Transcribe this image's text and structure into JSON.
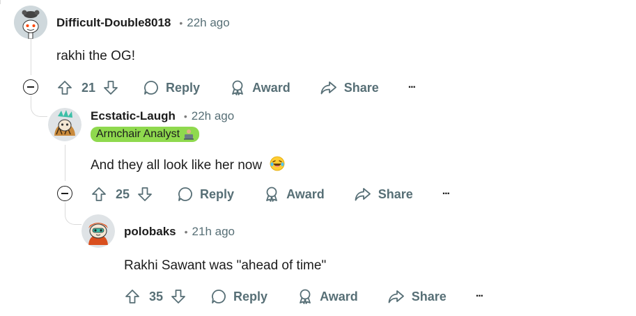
{
  "comments": [
    {
      "username": "Difficult-Double8018",
      "separator": "•",
      "time": "22h ago",
      "body": "rakhi the OG!",
      "score": "21",
      "actions": {
        "reply": "Reply",
        "award": "Award",
        "share": "Share",
        "more": "···"
      }
    },
    {
      "username": "Ecstatic-Laugh",
      "separator": "•",
      "time": "22h ago",
      "flair": "Armchair Analyst",
      "body": "And they all look like her now",
      "score": "25",
      "actions": {
        "reply": "Reply",
        "award": "Award",
        "share": "Share",
        "more": "···"
      }
    },
    {
      "username": "polobaks",
      "separator": "•",
      "time": "21h ago",
      "body": "Rakhi Sawant was \"ahead of time\"",
      "score": "35",
      "actions": {
        "reply": "Reply",
        "award": "Award",
        "share": "Share",
        "more": "···"
      }
    }
  ],
  "colors": {
    "flair_bg": "#8fd94e",
    "meta_text": "#576f76",
    "thread_line": "#dadada"
  },
  "icons": [
    "upvote-icon",
    "downvote-icon",
    "reply-bubble-icon",
    "award-icon",
    "share-icon",
    "more-icon",
    "collapse-icon",
    "laughing-emoji-icon",
    "laptop-emoji-icon"
  ]
}
